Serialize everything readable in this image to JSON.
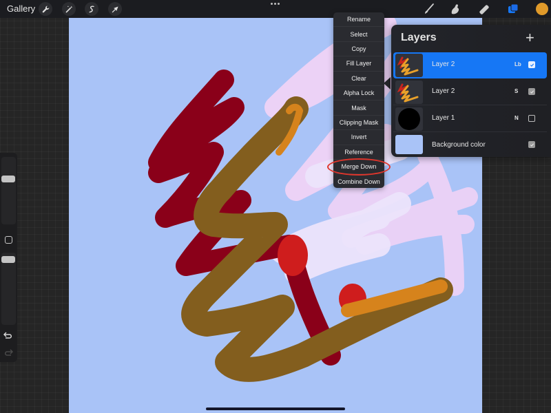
{
  "toolbar": {
    "gallery_label": "Gallery",
    "left_tools": [
      {
        "name": "actions",
        "icon": "wrench-icon"
      },
      {
        "name": "adjustments",
        "icon": "magic-wand-icon"
      },
      {
        "name": "selection",
        "icon": "selection-s-icon"
      },
      {
        "name": "transform",
        "icon": "arrow-cursor-icon"
      }
    ],
    "center_menu_icon": "more-dots-icon",
    "right_tools": [
      {
        "name": "brush",
        "icon": "brush-icon"
      },
      {
        "name": "smudge",
        "icon": "smudge-finger-icon"
      },
      {
        "name": "eraser",
        "icon": "eraser-icon"
      },
      {
        "name": "layers",
        "icon": "layers-icon",
        "active": true
      }
    ],
    "current_color": "#e09a2a"
  },
  "sidebar": {
    "brush_size_level": 0.35,
    "opacity_level": 0.05,
    "modifier_icon": "square-modifier-icon",
    "undo_icon": "undo-icon",
    "redo_icon": "redo-icon"
  },
  "context_menu": {
    "items": [
      {
        "label": "Rename"
      },
      {
        "label": "Select"
      },
      {
        "label": "Copy"
      },
      {
        "label": "Fill Layer"
      },
      {
        "label": "Clear"
      },
      {
        "label": "Alpha Lock"
      },
      {
        "label": "Mask"
      },
      {
        "label": "Clipping Mask"
      },
      {
        "label": "Invert"
      },
      {
        "label": "Reference"
      },
      {
        "label": "Merge Down",
        "highlighted": true
      },
      {
        "label": "Combine Down"
      }
    ]
  },
  "layers_panel": {
    "title": "Layers",
    "add_icon": "plus-icon",
    "layers": [
      {
        "name": "Layer 2",
        "blend": "Lb",
        "visible": true,
        "active": true,
        "thumbnail": "scribble"
      },
      {
        "name": "Layer 2",
        "blend": "S",
        "visible": true,
        "active": false,
        "thumbnail": "scribble"
      },
      {
        "name": "Layer 1",
        "blend": "N",
        "visible": false,
        "active": false,
        "thumbnail": "black-circle"
      },
      {
        "name": "Background color",
        "blend": "",
        "visible": true,
        "active": false,
        "thumbnail": "background",
        "color": "#a9c3f7"
      }
    ]
  },
  "canvas": {
    "background_color": "#a9c3f7",
    "stroke_colors": {
      "dark_red": "#8a0019",
      "brown": "#835e1e",
      "orange": "#d6831c",
      "bright_red": "#cf1d1d",
      "light_pink": "#efd3f5",
      "pale_lavender": "#ece4fb"
    }
  },
  "accent_color": "#1677f5",
  "highlight_color": "#e0352b"
}
